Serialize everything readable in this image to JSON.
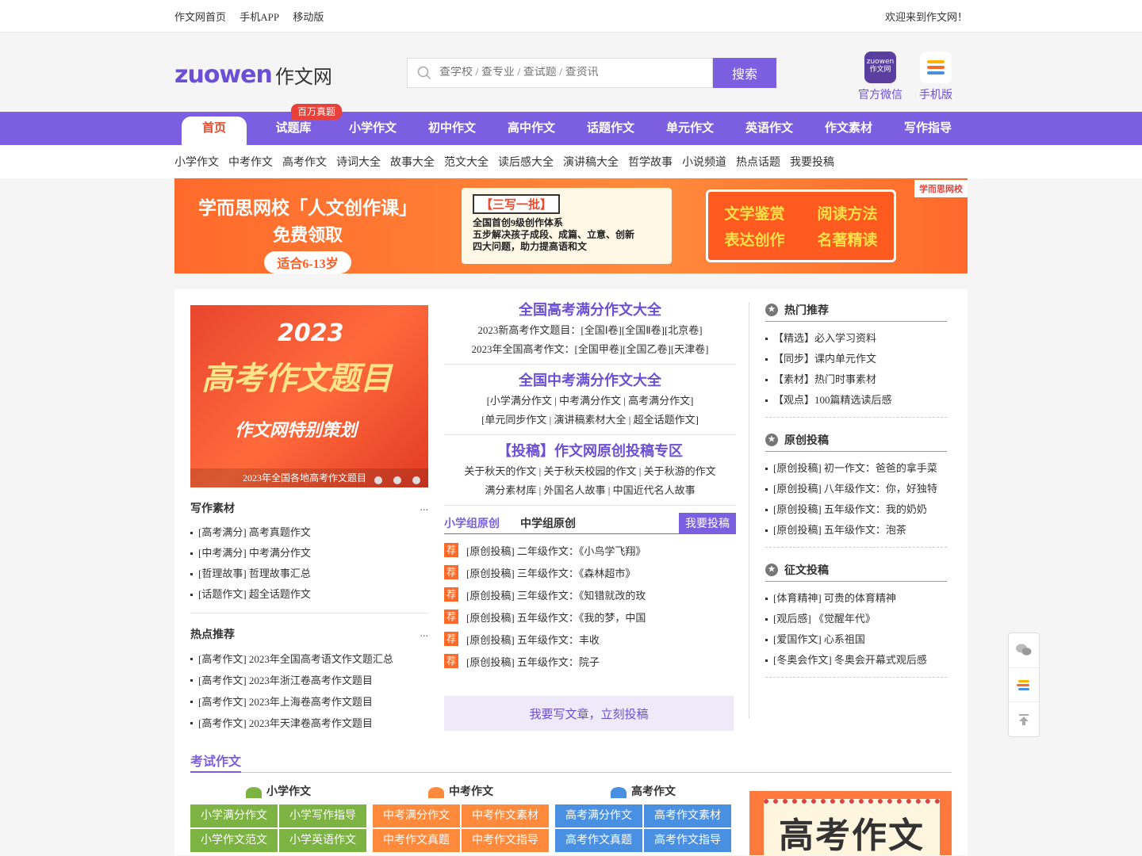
{
  "topbar": {
    "links": [
      "作文网首页",
      "手机APP",
      "移动版"
    ],
    "welcome": "欢迎来到作文网！"
  },
  "header": {
    "logo_en": "zuowen",
    "logo_cn": "作文网",
    "search_placeholder": "查学校 / 查专业 / 查试题 / 查资讯",
    "search_button": "搜索",
    "wechat_label": "官方微信",
    "wechat_icon_text": "zuowen 作文网",
    "mobile_label": "手机版"
  },
  "nav": {
    "items": [
      "首页",
      "试题库",
      "小学作文",
      "初中作文",
      "高中作文",
      "话题作文",
      "单元作文",
      "英语作文",
      "作文素材",
      "写作指导"
    ],
    "badge": "百万真题"
  },
  "subnav": [
    "小学作文",
    "中考作文",
    "高考作文",
    "诗词大全",
    "故事大全",
    "范文大全",
    "读后感大全",
    "演讲稿大全",
    "哲学故事",
    "小说频道",
    "热点话题",
    "我要投稿"
  ],
  "banner": {
    "left_title": "学而思网校「人文创作课」",
    "left_sub": "免费领取",
    "left_age": "适合6-13岁",
    "mid_tag": "【三写一批】",
    "mid_lines": [
      "全国首创9级创作体系",
      "五步解决孩子成段、成篇、立意、创新",
      "四大问题，助力提高语和文"
    ],
    "right_items": [
      "文学鉴赏",
      "阅读方法",
      "表达创作",
      "名著精读"
    ],
    "brand": "学而思网校"
  },
  "slide": {
    "year": "2023",
    "title": "高考作文题目",
    "subtitle": "作文网特别策划",
    "caption": "2023年全国各地高考作文题目"
  },
  "writing_material": {
    "title": "写作素材",
    "more": "...",
    "items": [
      "[高考满分] 高考真题作文",
      "[中考满分] 中考满分作文",
      "[哲理故事] 哲理故事汇总",
      "[话题作文] 超全话题作文"
    ]
  },
  "hot": {
    "title": "热点推荐",
    "more": "...",
    "items": [
      "[高考作文] 2023年全国高考语文作文题汇总",
      "[高考作文] 2023年浙江卷高考作文题目",
      "[高考作文] 2023年上海卷高考作文题目",
      "[高考作文] 2023年天津卷高考作文题目"
    ]
  },
  "features": [
    {
      "title": "全国高考满分作文大全",
      "lines": [
        "2023新高考作文题目：[全国Ⅰ卷][全国Ⅱ卷][北京卷]",
        "2023年全国高考作文：[全国甲卷][全国乙卷][天津卷]"
      ]
    },
    {
      "title": "全国中考满分作文大全",
      "lines": [
        "[小学满分作文 | 中考满分作文 | 高考满分作文]",
        "[单元同步作文 | 演讲稿素材大全 | 超全话题作文]"
      ]
    },
    {
      "title": "【投稿】作文网原创投稿专区",
      "lines": [
        "关于秋天的作文 | 关于秋天校园的作文 | 关于秋游的作文",
        "满分素材库 | 外国名人故事 | 中国近代名人故事"
      ]
    }
  ],
  "original": {
    "tab1": "小学组原创",
    "tab2": "中学组原创",
    "post": "我要投稿",
    "tag": "荐",
    "items": [
      "[原创投稿] 二年级作文：《小鸟学飞翔》",
      "[原创投稿] 三年级作文：《森林超市》",
      "[原创投稿] 三年级作文：《知错就改的玫",
      "[原创投稿] 五年级作文：《我的梦，中国",
      "[原创投稿] 五年级作文：丰收",
      "[原创投稿] 五年级作文：院子"
    ],
    "submit": "我要写文章，立刻投稿"
  },
  "right": [
    {
      "title": "热门推荐",
      "items": [
        "【精选】必入学习资料",
        "【同步】课内单元作文",
        "【素材】热门时事素材",
        "【观点】100篇精选读后感"
      ]
    },
    {
      "title": "原创投稿",
      "items": [
        "[原创投稿] 初一作文：爸爸的拿手菜",
        "[原创投稿] 八年级作文：你，好独特",
        "[原创投稿] 五年级作文：我的奶奶",
        "[原创投稿] 五年级作文：泡茶"
      ]
    },
    {
      "title": "征文投稿",
      "items": [
        "[体育精神] 可贵的体育精神",
        "[观后感] 《觉醒年代》",
        "[爱国作文] 心系祖国",
        "[冬奥会作文] 冬奥会开幕式观后感"
      ]
    }
  ],
  "exam": {
    "title": "考试作文",
    "groups": [
      {
        "title": "小学作文",
        "color": "#7cb342",
        "items": [
          "小学满分作文",
          "小学写作指导",
          "小学作文范文",
          "小学英语作文"
        ]
      },
      {
        "title": "中考作文",
        "color": "#ff8a3c",
        "items": [
          "中考满分作文",
          "中考作文素材",
          "中考作文真题",
          "中考作文指导"
        ]
      },
      {
        "title": "高考作文",
        "color": "#4a90e2",
        "items": [
          "高考满分作文",
          "高考作文素材",
          "高考作文真题",
          "高考作文指导"
        ]
      }
    ],
    "image_text": "高考作文"
  },
  "colors": {
    "brand": "#7b5fe0",
    "accent": "#e84a2b",
    "orange": "#ff6a2b"
  }
}
